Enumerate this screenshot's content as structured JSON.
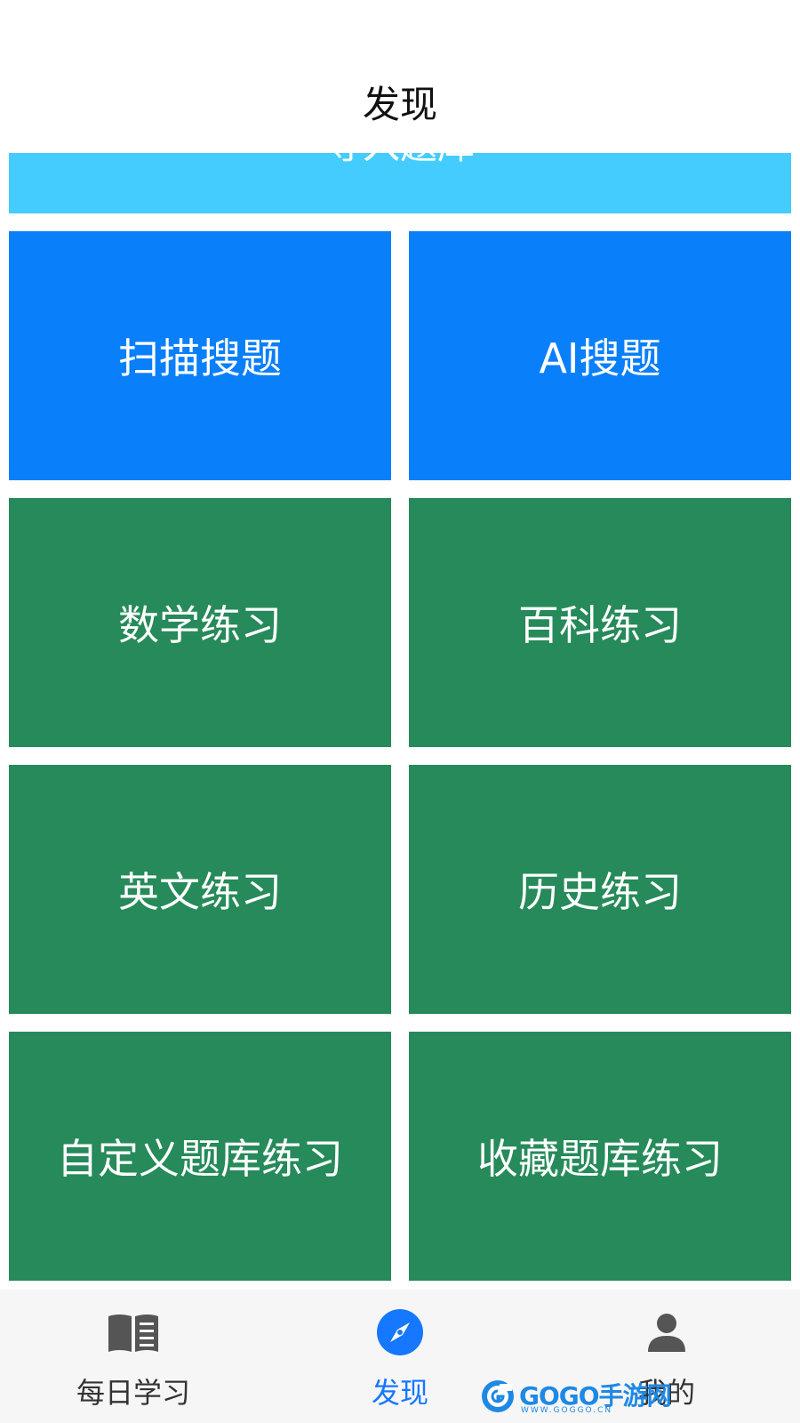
{
  "header": {
    "title": "发现"
  },
  "banner": {
    "label": "导入题库",
    "color": "#45ccff"
  },
  "tiles": [
    {
      "label": "扫描搜题",
      "color": "#0a7ffa"
    },
    {
      "label": "AI搜题",
      "color": "#0a7ffa"
    },
    {
      "label": "数学练习",
      "color": "#268a5a"
    },
    {
      "label": "百科练习",
      "color": "#268a5a"
    },
    {
      "label": "英文练习",
      "color": "#268a5a"
    },
    {
      "label": "历史练习",
      "color": "#268a5a"
    },
    {
      "label": "自定义题库练习",
      "color": "#268a5a"
    },
    {
      "label": "收藏题库练习",
      "color": "#268a5a"
    }
  ],
  "bottom_nav": {
    "items": [
      {
        "label": "每日学习",
        "icon": "book-icon",
        "active": false
      },
      {
        "label": "发现",
        "icon": "compass-icon",
        "active": true
      },
      {
        "label": "我的",
        "icon": "user-icon",
        "active": false
      }
    ],
    "active_color": "#1677ff",
    "inactive_color": "#333333"
  },
  "watermark": {
    "text": "GOGO手游网",
    "sub": "WWW.GOGGO.CN",
    "icon": "gogo-logo-icon"
  }
}
